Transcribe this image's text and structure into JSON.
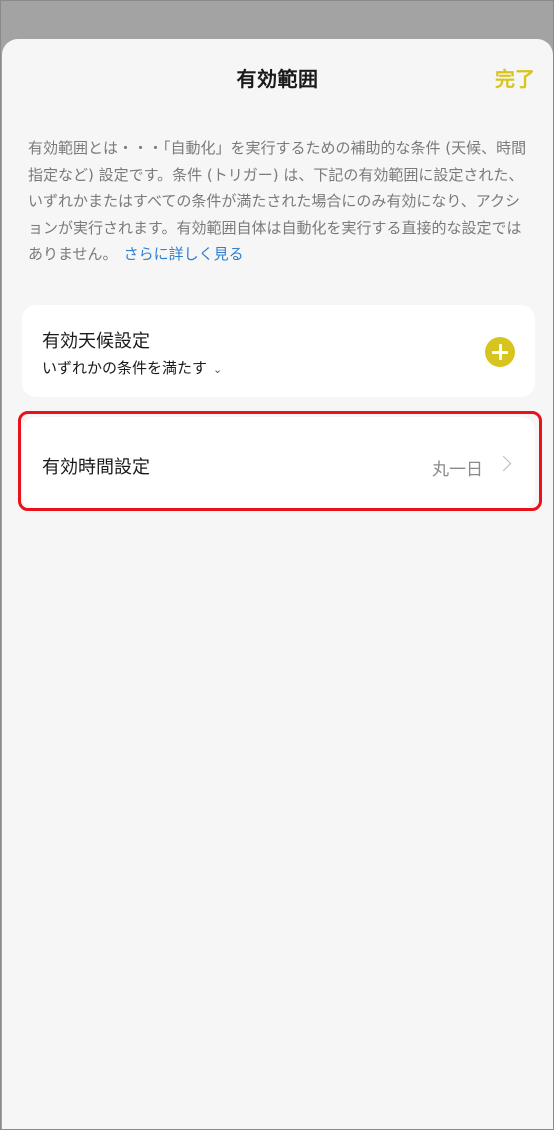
{
  "header": {
    "title": "有効範囲",
    "done_label": "完了"
  },
  "description": {
    "text": "有効範囲とは・・・「自動化」を実行するための補助的な条件 (天候、時間指定など) 設定です。条件 (トリガー) は、下記の有効範囲に設定された、いずれかまたはすべての条件が満たされた場合にのみ有効になり、アクションが実行されます。有効範囲自体は自動化を実行する直接的な設定ではありません。",
    "link_label": "さらに詳しく見る"
  },
  "weather_card": {
    "title": "有効天候設定",
    "condition_label": "いずれかの条件を満たす",
    "add_icon": "plus-circle-icon"
  },
  "time_card": {
    "title": "有効時間設定",
    "value": "丸一日",
    "chevron_icon": "chevron-right-icon"
  },
  "colors": {
    "accent": "#d8c41f",
    "link": "#2f7fd1",
    "highlight": "#e8121b"
  }
}
